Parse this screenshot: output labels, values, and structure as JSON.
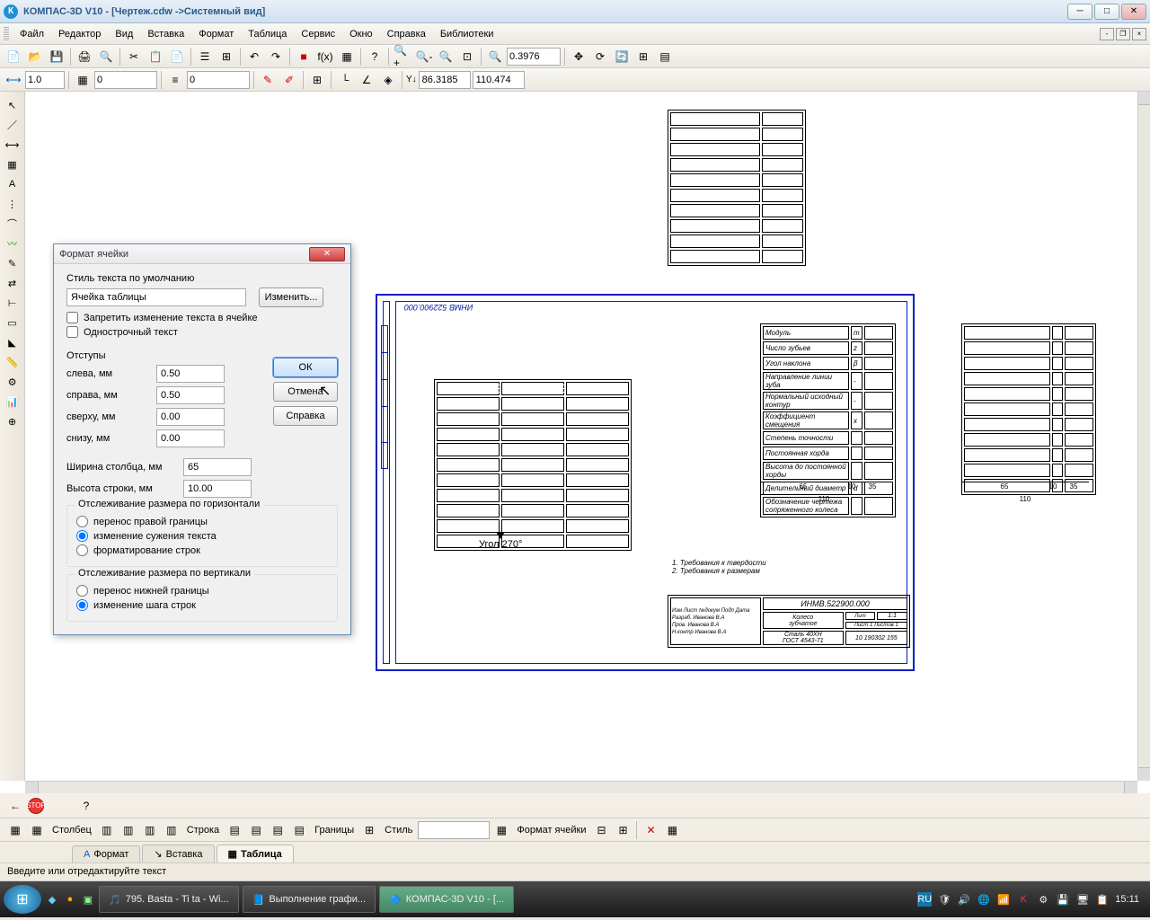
{
  "title": "КОМПАС-3D V10 - [Чертеж.cdw ->Системный вид]",
  "menu": [
    "Файл",
    "Редактор",
    "Вид",
    "Вставка",
    "Формат",
    "Таблица",
    "Сервис",
    "Окно",
    "Справка",
    "Библиотеки"
  ],
  "toolbar1": {
    "zoom": "0.3976"
  },
  "toolbar2": {
    "scale": "1.0",
    "layer": "0",
    "style": "0",
    "coordX": "86.3185",
    "coordY": "110.474"
  },
  "dialog": {
    "title": "Формат ячейки",
    "style_lbl": "Стиль текста по умолчанию",
    "style_value": "Ячейка таблицы",
    "change_btn": "Изменить...",
    "lock_text": "Запретить изменение текста в ячейке",
    "single_line": "Однострочный текст",
    "indents_legend": "Отступы",
    "left_lbl": "слева, мм",
    "left_v": "0.50",
    "right_lbl": "справа, мм",
    "right_v": "0.50",
    "top_lbl": "сверху, мм",
    "top_v": "0.00",
    "bottom_lbl": "снизу, мм",
    "bottom_v": "0.00",
    "colw_lbl": "Ширина столбца, мм",
    "colw_v": "65",
    "rowh_lbl": "Высота строки, мм",
    "rowh_v": "10.00",
    "hgroup": "Отслеживание размера по горизонтали",
    "h_r1": "перенос правой границы",
    "h_r2": "изменение сужения текста",
    "h_r3": "форматирование строк",
    "vgroup": "Отслеживание размера по вертикали",
    "v_r1": "перенос нижней границы",
    "v_r2": "изменение шага строк",
    "ok": "ОК",
    "cancel": "Отмена",
    "help": "Справка"
  },
  "canvas": {
    "angle": "Угол 270°",
    "frame_text": "ИНМВ 522900.000",
    "notes1": "1. Требования к твердости",
    "notes2": "2. Требования к размерам",
    "stamp": {
      "code": "ИНМВ.522900.000",
      "name1": "Колесо",
      "name2": "зубчатое",
      "mat": "Сталь 40ХН\nГОСТ 4543-71",
      "scale": "1:1",
      "sheet": "10 190302 155"
    },
    "params": [
      "Модуль",
      "Число зубьев",
      "Угол наклона",
      "Направление линии зуба",
      "Нормальный исходный контур",
      "Коэффициент смещения",
      "Степень точности",
      "Постоянная хорда",
      "Высота до постоянной хорды",
      "Делительный диаметр",
      "Обозначение чертежа\nсопряженного колеса"
    ],
    "param_sym": [
      "m",
      "z",
      "β",
      "-",
      "-",
      "x",
      "",
      "",
      "",
      "d",
      ""
    ],
    "dim65": "65",
    "dim10": "10",
    "dim35": "35",
    "dim110": "110"
  },
  "bottom": {
    "col_lbl": "Столбец",
    "row_lbl": "Строка",
    "bnd_lbl": "Границы",
    "style_lbl": "Стиль",
    "fmt_lbl": "Формат ячейки",
    "tab1": "Формат",
    "tab2": "Вставка",
    "tab3": "Таблица"
  },
  "status": "Введите или отредактируйте текст",
  "taskbar": {
    "task1": "795. Basta - Ti ta - Wi...",
    "task2": "Выполнение графи...",
    "task3": "КОМПАС-3D V10 - [...",
    "lang": "RU",
    "time": "15:11"
  }
}
